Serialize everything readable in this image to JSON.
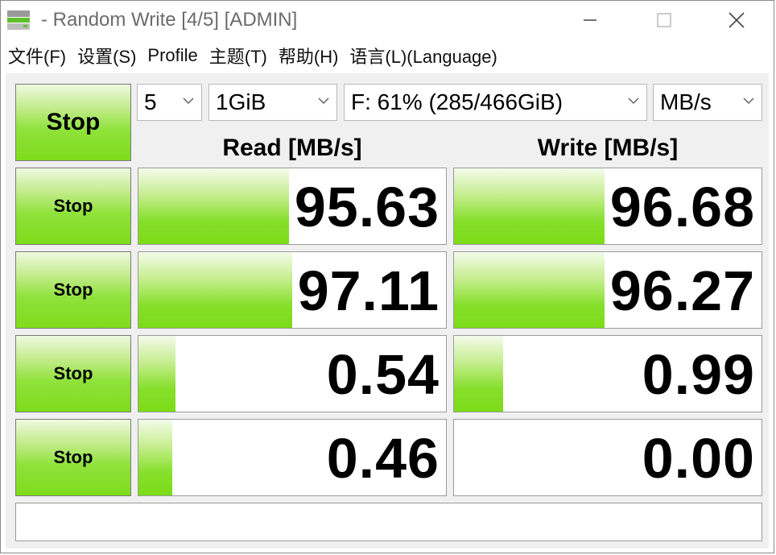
{
  "window": {
    "title": "- Random Write [4/5] [ADMIN]",
    "icon": "drive-icon"
  },
  "menu": [
    "文件(F)",
    "设置(S)",
    "Profile",
    "主题(T)",
    "帮助(H)",
    "语言(L)(Language)"
  ],
  "controls": {
    "main_button": "Stop",
    "count": "5",
    "size": "1GiB",
    "drive": "F: 61% (285/466GiB)",
    "unit": "MB/s"
  },
  "headers": {
    "read": "Read [MB/s]",
    "write": "Write [MB/s]"
  },
  "rows": [
    {
      "button": "Stop",
      "read": "95.63",
      "write": "96.68",
      "read_fill": 0.49,
      "write_fill": 0.49
    },
    {
      "button": "Stop",
      "read": "97.11",
      "write": "96.27",
      "read_fill": 0.5,
      "write_fill": 0.49
    },
    {
      "button": "Stop",
      "read": "0.54",
      "write": "0.99",
      "read_fill": 0.12,
      "write_fill": 0.16
    },
    {
      "button": "Stop",
      "read": "0.46",
      "write": "0.00",
      "read_fill": 0.11,
      "write_fill": 0.0
    }
  ],
  "comment": "",
  "colors": {
    "bar_green": "#7ddb18",
    "button_green": "#8fe23a"
  }
}
